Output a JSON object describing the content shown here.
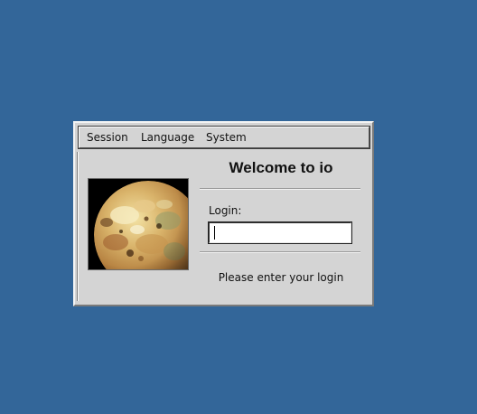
{
  "desktop": {
    "background_color": "#336699"
  },
  "menubar": {
    "items": [
      {
        "label": "Session"
      },
      {
        "label": "Language"
      },
      {
        "label": "System"
      }
    ]
  },
  "greeter": {
    "title": "Welcome to io",
    "login_label": "Login:",
    "login_value": "",
    "status_message": "Please enter your login",
    "logo_icon": "io-moon-planet-image"
  }
}
